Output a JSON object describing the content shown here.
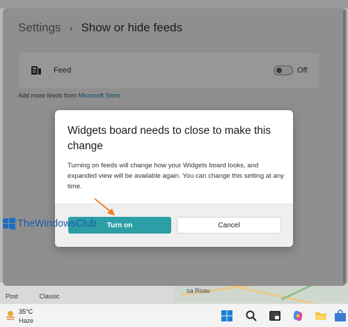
{
  "settings": {
    "breadcrumb_root": "Settings",
    "breadcrumb_sep": "›",
    "breadcrumb_current": "Show or hide feeds",
    "feed_label": "Feed",
    "toggle_state_text": "Off",
    "more_feeds_prefix": "Add more feeds from ",
    "more_feeds_link": "Microsoft Store"
  },
  "dialog": {
    "title": "Widgets board needs to close to make this change",
    "body": "Turning on feeds will change how your Widgets board looks, and expanded view will be available again. You can change this setting at any time.",
    "primary_button": "Turn on",
    "secondary_button": "Cancel",
    "accent_color": "#2b9ea6"
  },
  "watermark": {
    "text": "TheWindowsClub"
  },
  "background": {
    "tab_post": "Post",
    "tab_classic": "Classic",
    "map_label": "sa Roau"
  },
  "taskbar": {
    "weather_temp": "35°C",
    "weather_condition": "Haze",
    "icons": [
      "weather-icon",
      "windows-start-icon",
      "search-icon",
      "terminal-icon",
      "copilot-icon",
      "file-explorer-icon",
      "store-icon"
    ]
  },
  "arrow_color": "#f07d1e"
}
